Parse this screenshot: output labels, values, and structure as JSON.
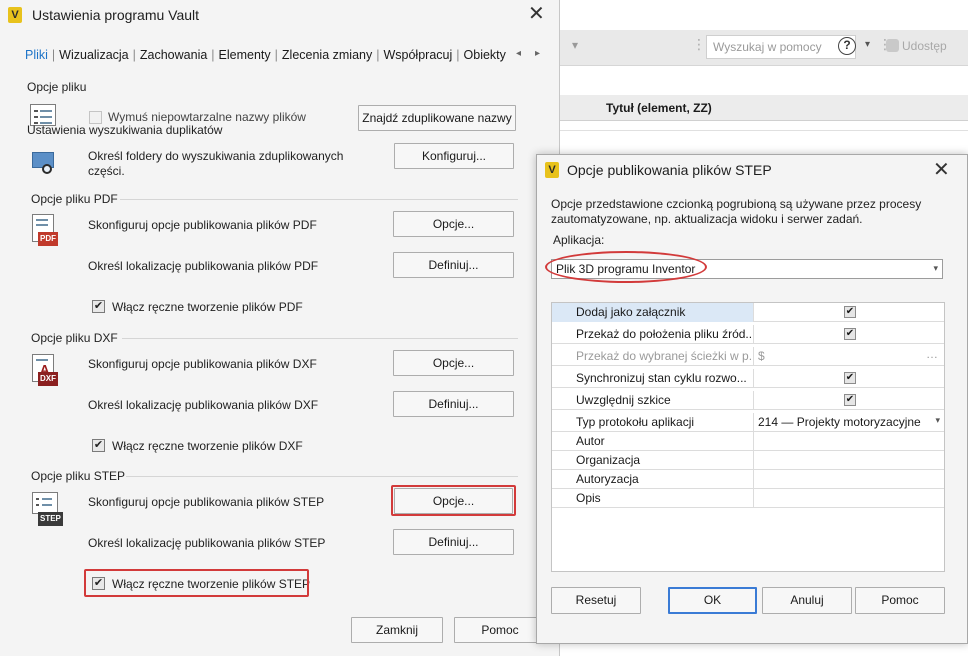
{
  "background_app": {
    "search_placeholder": "Wyszukaj w pomocy",
    "share_label": "Udostęp",
    "column_header": "Tytuł (element, ZZ)"
  },
  "main_dialog": {
    "app_icon": "V",
    "title": "Ustawienia programu Vault",
    "tabs": [
      "Pliki",
      "Wizualizacja",
      "Zachowania",
      "Elementy",
      "Zlecenia zmiany",
      "Współpracuj",
      "Obiekty"
    ],
    "file_options": {
      "header": "Opcje pliku",
      "unique_names_label": "Wymuś niepowtarzalne nazwy plików",
      "unique_names_checked": false,
      "find_duplicates_button": "Znajdź zduplikowane nazwy",
      "duplicate_search_header": "Ustawienia wyszukiwania duplikatów",
      "folders_label_1": "Określ foldery do wyszukiwania zduplikowanych",
      "folders_label_2": "części.",
      "configure_button": "Konfiguruj..."
    },
    "pdf": {
      "header": "Opcje pliku PDF",
      "tag": "PDF",
      "configure_label": "Skonfiguruj opcje publikowania plików PDF",
      "options_button": "Opcje...",
      "location_label": "Określ lokalizację publikowania plików PDF",
      "define_button": "Definiuj...",
      "manual_label": "Włącz ręczne tworzenie plików PDF",
      "manual_checked": true
    },
    "dxf": {
      "header": "Opcje pliku DXF",
      "tag": "DXF",
      "configure_label": "Skonfiguruj opcje publikowania plików DXF",
      "options_button": "Opcje...",
      "location_label": "Określ lokalizację publikowania plików DXF",
      "define_button": "Definiuj...",
      "manual_label": "Włącz ręczne tworzenie plików DXF",
      "manual_checked": true
    },
    "step": {
      "header": "Opcje pliku STEP",
      "tag": "STEP",
      "configure_label": "Skonfiguruj opcje publikowania plików STEP",
      "options_button": "Opcje...",
      "location_label": "Określ lokalizację publikowania plików STEP",
      "define_button": "Definiuj...",
      "manual_label": "Włącz ręczne tworzenie plików STEP",
      "manual_checked": true
    },
    "close_button": "Zamknij",
    "help_button": "Pomoc"
  },
  "step_dialog": {
    "app_icon": "V",
    "title": "Opcje publikowania plików STEP",
    "description": "Opcje przedstawione czcionką pogrubioną są używane przez procesy zautomatyzowane, np. aktualizacja widoku i serwer zadań.",
    "application_label": "Aplikacja:",
    "application_value": "Plik 3D programu Inventor",
    "properties": [
      {
        "name": "Dodaj jako załącznik",
        "value": "",
        "checked": true
      },
      {
        "name": "Przekaż do położenia pliku źród...",
        "value": "",
        "checked": true
      },
      {
        "name": "Przekaż do wybranej ścieżki w p...",
        "value": "$",
        "disabled": true
      },
      {
        "name": "Synchronizuj stan cyklu rozwo...",
        "value": "",
        "checked": true
      },
      {
        "name": "Uwzględnij szkice",
        "value": "",
        "checked": true
      },
      {
        "name": "Typ protokołu aplikacji",
        "value": "214 — Projekty motoryzacyjne"
      },
      {
        "name": "Autor",
        "value": ""
      },
      {
        "name": "Organizacja",
        "value": ""
      },
      {
        "name": "Autoryzacja",
        "value": ""
      },
      {
        "name": "Opis",
        "value": ""
      }
    ],
    "reset_button": "Resetuj",
    "ok_button": "OK",
    "cancel_button": "Anuluj",
    "help_button": "Pomoc"
  },
  "colors": {
    "active_tab": "#1e74c8",
    "highlight": "#d23a3a",
    "selected_row": "#dbe8f6",
    "pdf_tag": "#c0392b",
    "dxf_tag": "#8b1f1f",
    "step_tag": "#3a3a3a"
  }
}
